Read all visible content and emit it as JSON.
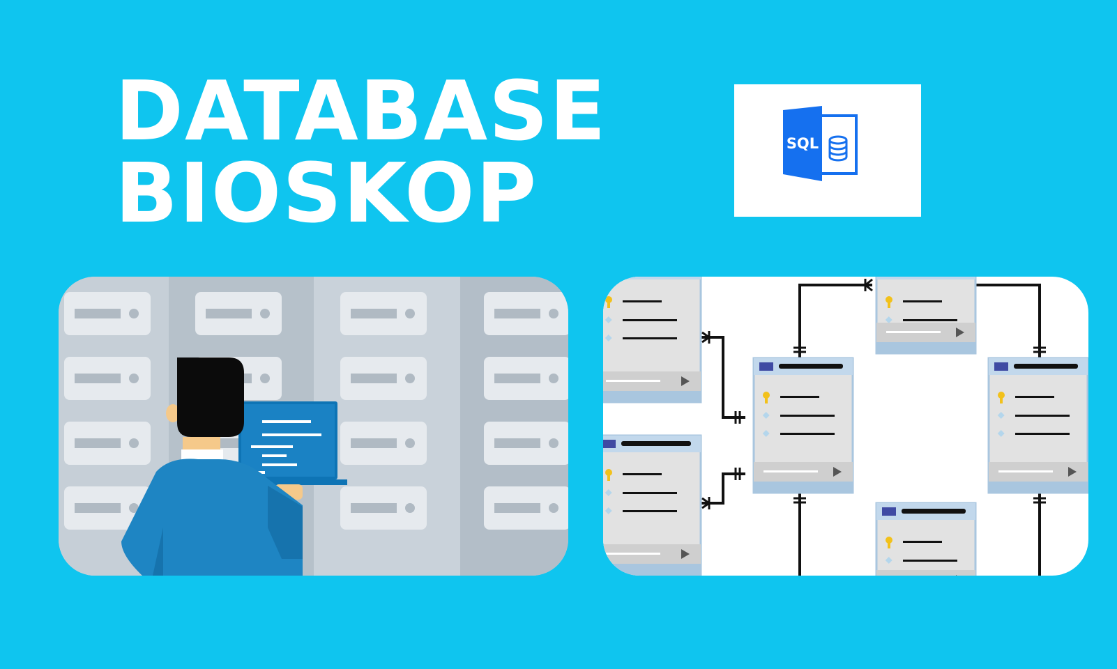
{
  "title": {
    "line1": "DATABASE",
    "line2": "BIOSKOP"
  },
  "logo": {
    "text": "SQL",
    "color": "#1570ef",
    "icon": "sql-database-file-icon"
  },
  "colors": {
    "background": "#0fc5ef",
    "title": "#ffffff"
  },
  "illustrations": {
    "left": "server-room-developer-illustration",
    "right": "er-diagram-illustration"
  }
}
